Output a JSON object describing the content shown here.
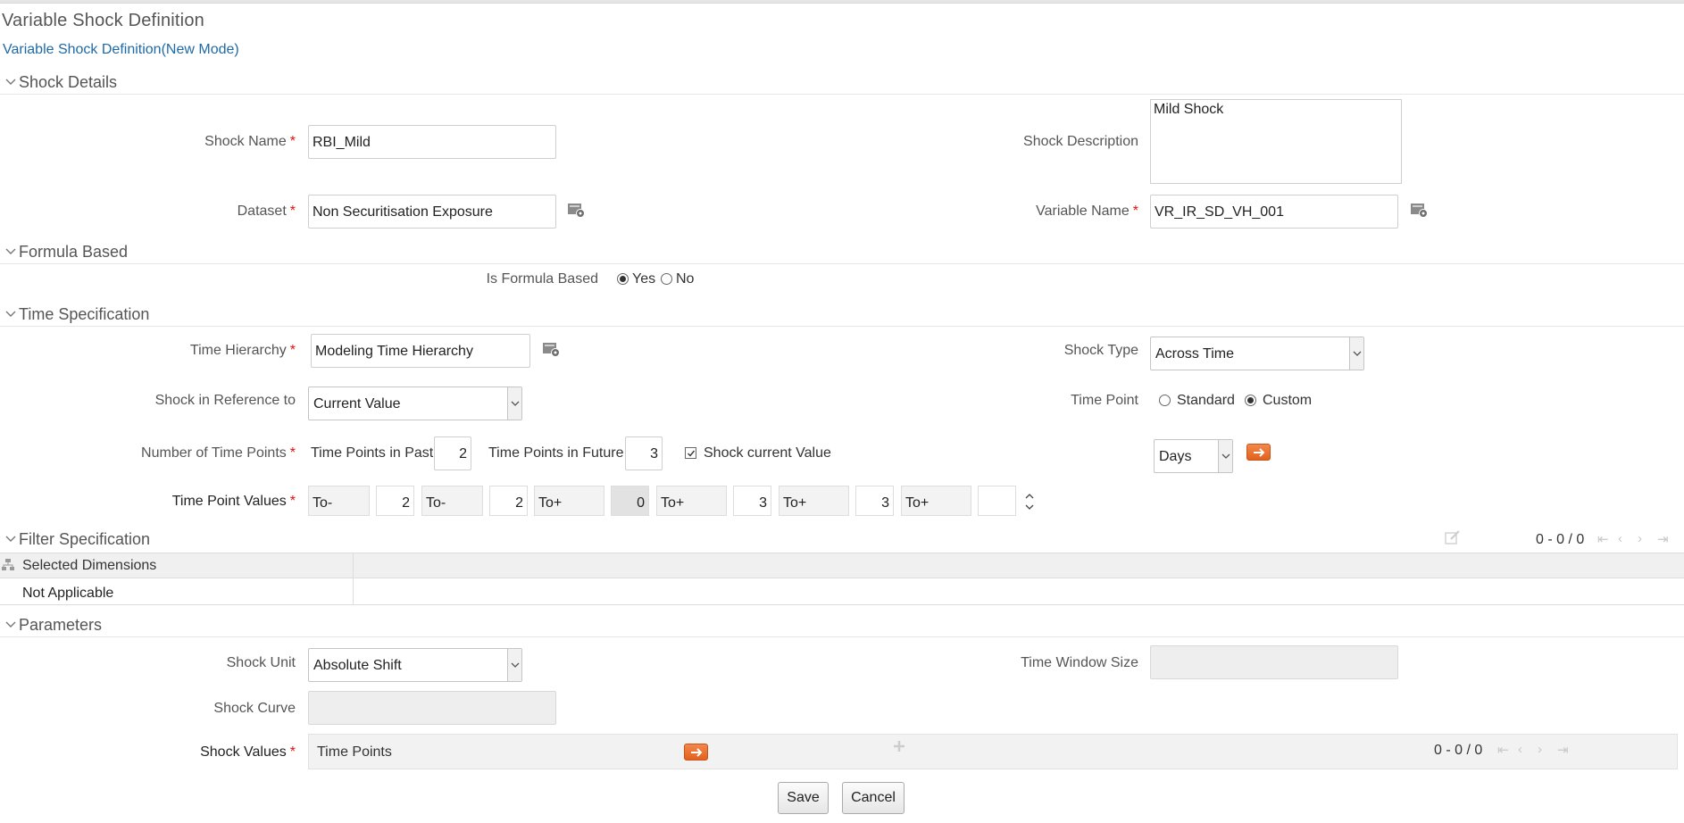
{
  "page": {
    "title": "Variable Shock Definition",
    "mode_link": "Variable Shock Definition(New Mode)"
  },
  "sections": {
    "shock_details": "Shock Details",
    "formula_based": "Formula Based",
    "time_specification": "Time Specification",
    "filter_specification": "Filter Specification",
    "parameters": "Parameters"
  },
  "shock_details": {
    "shock_name_label": "Shock Name",
    "shock_name_value": "RBI_Mild",
    "shock_description_label": "Shock Description",
    "shock_description_value": "Mild Shock",
    "dataset_label": "Dataset",
    "dataset_value": "Non Securitisation Exposure",
    "variable_name_label": "Variable Name",
    "variable_name_value": "VR_IR_SD_VH_001",
    "required_marker": "*"
  },
  "formula": {
    "label": "Is Formula Based",
    "yes": "Yes",
    "no": "No",
    "selected": "Yes"
  },
  "time_spec": {
    "time_hierarchy_label": "Time Hierarchy",
    "time_hierarchy_value": "Modeling Time Hierarchy",
    "shock_type_label": "Shock Type",
    "shock_type_value": "Across Time",
    "reference_label": "Shock in Reference to",
    "reference_value": "Current Value",
    "time_point_label": "Time Point",
    "standard": "Standard",
    "custom": "Custom",
    "time_point_selected": "Custom",
    "num_points_label": "Number of Time Points",
    "past_label": "Time Points in Past",
    "past_value": "2",
    "future_label": "Time Points in Future",
    "future_value": "3",
    "shock_current_label": "Shock current Value",
    "shock_current_checked": true,
    "unit_value": "Days",
    "values_label": "Time Point Values",
    "values": [
      {
        "prefix": "To-",
        "num": "2"
      },
      {
        "prefix": "To-",
        "num": "2"
      },
      {
        "prefix": "To+",
        "num": "0"
      },
      {
        "prefix": "To+",
        "num": "3"
      },
      {
        "prefix": "To+",
        "num": "3"
      },
      {
        "prefix": "To+",
        "num": ""
      }
    ]
  },
  "filter": {
    "pager": "0 - 0 / 0",
    "column_header": "Selected Dimensions",
    "row_value": "Not Applicable"
  },
  "parameters": {
    "shock_unit_label": "Shock Unit",
    "shock_unit_value": "Absolute Shift",
    "time_window_label": "Time Window Size",
    "time_window_value": "",
    "shock_curve_label": "Shock Curve",
    "shock_curve_value": "",
    "shock_values_label": "Shock Values",
    "time_points_header": "Time Points",
    "pager": "0 - 0 / 0"
  },
  "buttons": {
    "save": "Save",
    "cancel": "Cancel"
  },
  "colors": {
    "link": "#1e6aa6",
    "required": "#dd1111",
    "orange_button": "#e2611e"
  },
  "icons": {
    "section_toggle": "chevron-down-icon",
    "hierarchy_browser": "hierarchy-browser-icon",
    "go": "arrow-right-icon",
    "add": "plus-icon",
    "edit": "edit-icon",
    "first": "first-page-icon",
    "prev": "previous-page-icon",
    "next": "next-page-icon",
    "last": "last-page-icon",
    "dimensions": "dimensions-icon"
  }
}
